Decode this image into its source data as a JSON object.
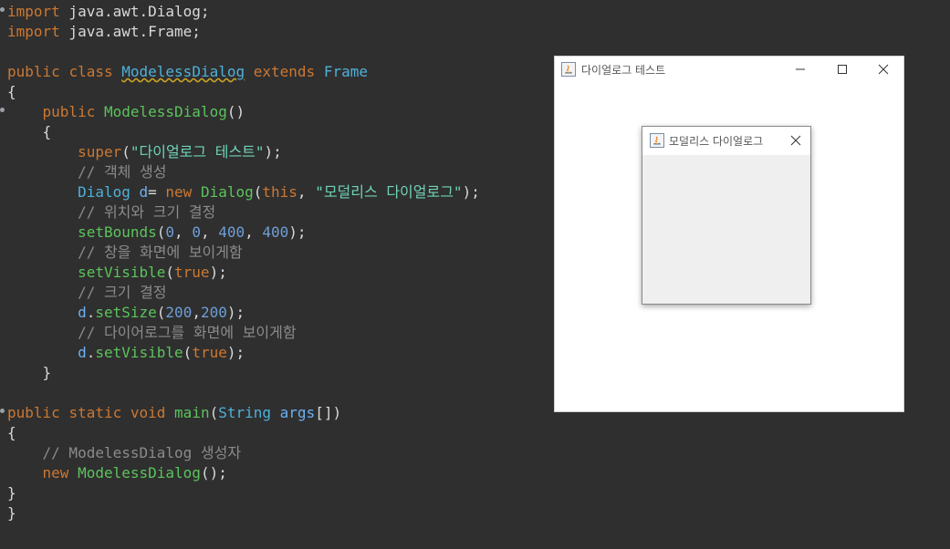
{
  "editor": {
    "lines": [
      [
        {
          "t": "import",
          "c": "kw"
        },
        {
          "t": " java.awt.Dialog;",
          "c": "txt"
        }
      ],
      [
        {
          "t": "import",
          "c": "kw"
        },
        {
          "t": " java.awt.Frame;",
          "c": "txt"
        }
      ],
      [],
      [
        {
          "t": "public",
          "c": "kw"
        },
        {
          "t": " ",
          "c": "txt"
        },
        {
          "t": "class",
          "c": "kw"
        },
        {
          "t": " ",
          "c": "txt"
        },
        {
          "t": "ModelessDialog",
          "c": "cls-u"
        },
        {
          "t": " ",
          "c": "txt"
        },
        {
          "t": "extends",
          "c": "kw"
        },
        {
          "t": " ",
          "c": "txt"
        },
        {
          "t": "Frame",
          "c": "cls"
        }
      ],
      [
        {
          "t": "{",
          "c": "txt"
        }
      ],
      [
        {
          "t": "    ",
          "c": "txt"
        },
        {
          "t": "public",
          "c": "kw"
        },
        {
          "t": " ",
          "c": "txt"
        },
        {
          "t": "ModelessDialog",
          "c": "method"
        },
        {
          "t": "()",
          "c": "txt"
        }
      ],
      [
        {
          "t": "    {",
          "c": "txt"
        }
      ],
      [
        {
          "t": "        ",
          "c": "txt"
        },
        {
          "t": "super",
          "c": "kw"
        },
        {
          "t": "(",
          "c": "txt"
        },
        {
          "t": "\"다이얼로그 테스트\"",
          "c": "str"
        },
        {
          "t": ");",
          "c": "txt"
        }
      ],
      [
        {
          "t": "        // 객체 생성",
          "c": "cm"
        }
      ],
      [
        {
          "t": "        ",
          "c": "txt"
        },
        {
          "t": "Dialog",
          "c": "cls"
        },
        {
          "t": " ",
          "c": "txt"
        },
        {
          "t": "d",
          "c": "var"
        },
        {
          "t": "= ",
          "c": "txt"
        },
        {
          "t": "new",
          "c": "kw"
        },
        {
          "t": " ",
          "c": "txt"
        },
        {
          "t": "Dialog",
          "c": "method"
        },
        {
          "t": "(",
          "c": "txt"
        },
        {
          "t": "this",
          "c": "kw"
        },
        {
          "t": ", ",
          "c": "txt"
        },
        {
          "t": "\"모덜리스 다이얼로그\"",
          "c": "str"
        },
        {
          "t": ");",
          "c": "txt"
        }
      ],
      [
        {
          "t": "        // 위치와 크기 결정",
          "c": "cm"
        }
      ],
      [
        {
          "t": "        ",
          "c": "txt"
        },
        {
          "t": "setBounds",
          "c": "method"
        },
        {
          "t": "(",
          "c": "txt"
        },
        {
          "t": "0",
          "c": "num"
        },
        {
          "t": ", ",
          "c": "txt"
        },
        {
          "t": "0",
          "c": "num"
        },
        {
          "t": ", ",
          "c": "txt"
        },
        {
          "t": "400",
          "c": "num"
        },
        {
          "t": ", ",
          "c": "txt"
        },
        {
          "t": "400",
          "c": "num"
        },
        {
          "t": ");",
          "c": "txt"
        }
      ],
      [
        {
          "t": "        // 창을 화면에 보이게함",
          "c": "cm"
        }
      ],
      [
        {
          "t": "        ",
          "c": "txt"
        },
        {
          "t": "setVisible",
          "c": "method"
        },
        {
          "t": "(",
          "c": "txt"
        },
        {
          "t": "true",
          "c": "kw"
        },
        {
          "t": ");",
          "c": "txt"
        }
      ],
      [
        {
          "t": "        // 크기 결정",
          "c": "cm"
        }
      ],
      [
        {
          "t": "        ",
          "c": "txt"
        },
        {
          "t": "d",
          "c": "var"
        },
        {
          "t": ".",
          "c": "txt"
        },
        {
          "t": "setSize",
          "c": "method"
        },
        {
          "t": "(",
          "c": "txt"
        },
        {
          "t": "200",
          "c": "num"
        },
        {
          "t": ",",
          "c": "txt"
        },
        {
          "t": "200",
          "c": "num"
        },
        {
          "t": ");",
          "c": "txt"
        }
      ],
      [
        {
          "t": "        // 다이어로그를 화면에 보이게함",
          "c": "cm"
        }
      ],
      [
        {
          "t": "        ",
          "c": "txt"
        },
        {
          "t": "d",
          "c": "var"
        },
        {
          "t": ".",
          "c": "txt"
        },
        {
          "t": "setVisible",
          "c": "method"
        },
        {
          "t": "(",
          "c": "txt"
        },
        {
          "t": "true",
          "c": "kw"
        },
        {
          "t": ");",
          "c": "txt"
        }
      ],
      [
        {
          "t": "    }",
          "c": "txt"
        }
      ],
      [],
      [
        {
          "t": "public",
          "c": "kw"
        },
        {
          "t": " ",
          "c": "txt"
        },
        {
          "t": "static",
          "c": "kw"
        },
        {
          "t": " ",
          "c": "txt"
        },
        {
          "t": "void",
          "c": "kw"
        },
        {
          "t": " ",
          "c": "txt"
        },
        {
          "t": "main",
          "c": "method"
        },
        {
          "t": "(",
          "c": "txt"
        },
        {
          "t": "String",
          "c": "cls"
        },
        {
          "t": " ",
          "c": "txt"
        },
        {
          "t": "args",
          "c": "var"
        },
        {
          "t": "[])",
          "c": "txt"
        }
      ],
      [
        {
          "t": "{",
          "c": "txt"
        }
      ],
      [
        {
          "t": "    // ModelessDialog 생성자",
          "c": "cm"
        }
      ],
      [
        {
          "t": "    ",
          "c": "txt"
        },
        {
          "t": "new",
          "c": "kw"
        },
        {
          "t": " ",
          "c": "txt"
        },
        {
          "t": "ModelessDialog",
          "c": "method"
        },
        {
          "t": "();",
          "c": "txt"
        }
      ],
      [
        {
          "t": "}",
          "c": "txt"
        }
      ],
      [
        {
          "t": "}",
          "c": "txt"
        }
      ]
    ],
    "colors": {
      "background": "#2f2f2f",
      "keyword": "#cc7832",
      "class": "#4fb0d8",
      "method": "#5cc35c",
      "string": "#6fd3b6",
      "number": "#6f9fd8",
      "comment": "#8b8b8b"
    }
  },
  "frame_window": {
    "title": "다이얼로그 테스트",
    "icon": "java-icon",
    "controls": [
      "minimize-icon",
      "maximize-icon",
      "close-icon"
    ]
  },
  "dialog_window": {
    "title": "모덜리스 다이얼로그",
    "icon": "java-icon",
    "controls": [
      "close-icon"
    ]
  }
}
